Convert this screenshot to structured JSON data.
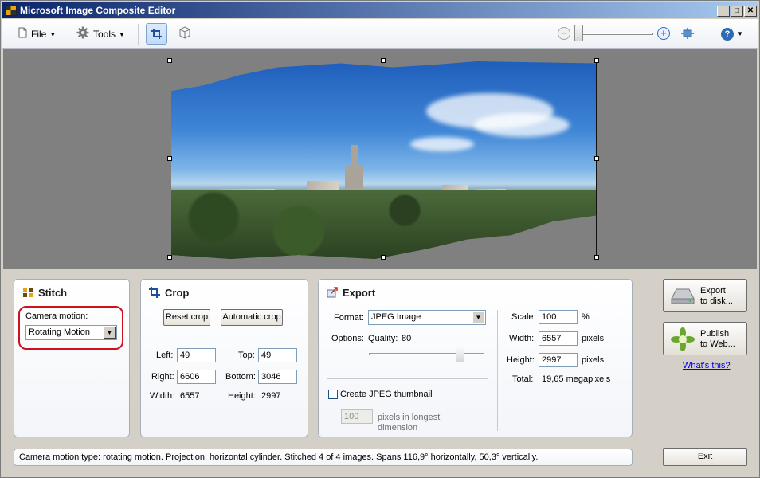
{
  "window": {
    "title": "Microsoft Image Composite Editor"
  },
  "toolbar": {
    "file_label": "File",
    "tools_label": "Tools",
    "help_label": "?"
  },
  "stitch": {
    "title": "Stitch",
    "camera_motion_label": "Camera motion:",
    "camera_motion_value": "Rotating Motion"
  },
  "crop": {
    "title": "Crop",
    "reset_label": "Reset crop",
    "auto_label": "Automatic crop",
    "left_label": "Left:",
    "left_value": "49",
    "top_label": "Top:",
    "top_value": "49",
    "right_label": "Right:",
    "right_value": "6606",
    "bottom_label": "Bottom:",
    "bottom_value": "3046",
    "width_label": "Width:",
    "width_value": "6557",
    "height_label": "Height:",
    "height_value": "2997"
  },
  "export": {
    "title": "Export",
    "format_label": "Format:",
    "format_value": "JPEG Image",
    "options_label": "Options:",
    "quality_label": "Quality:",
    "quality_value": "80",
    "thumbnail_label": "Create JPEG thumbnail",
    "thumbnail_value": "100",
    "thumbnail_desc_1": "pixels in longest",
    "thumbnail_desc_2": "dimension",
    "scale_label": "Scale:",
    "scale_value": "100",
    "scale_unit": "%",
    "width_label": "Width:",
    "width_value": "6557",
    "width_unit": "pixels",
    "height_label": "Height:",
    "height_value": "2997",
    "height_unit": "pixels",
    "total_label": "Total:",
    "total_value": "19,65 megapixels"
  },
  "actions": {
    "export_disk_1": "Export",
    "export_disk_2": "to disk...",
    "publish_web_1": "Publish",
    "publish_web_2": "to Web...",
    "whats_this": "What's this?",
    "exit_label": "Exit"
  },
  "status_text": "Camera motion type: rotating motion. Projection: horizontal cylinder. Stitched 4 of 4 images. Spans 116,9° horizontally, 50,3° vertically.",
  "colors": {
    "accent": "#2e6bb5",
    "highlight_ring": "#d0101a",
    "canvas": "#808080"
  }
}
